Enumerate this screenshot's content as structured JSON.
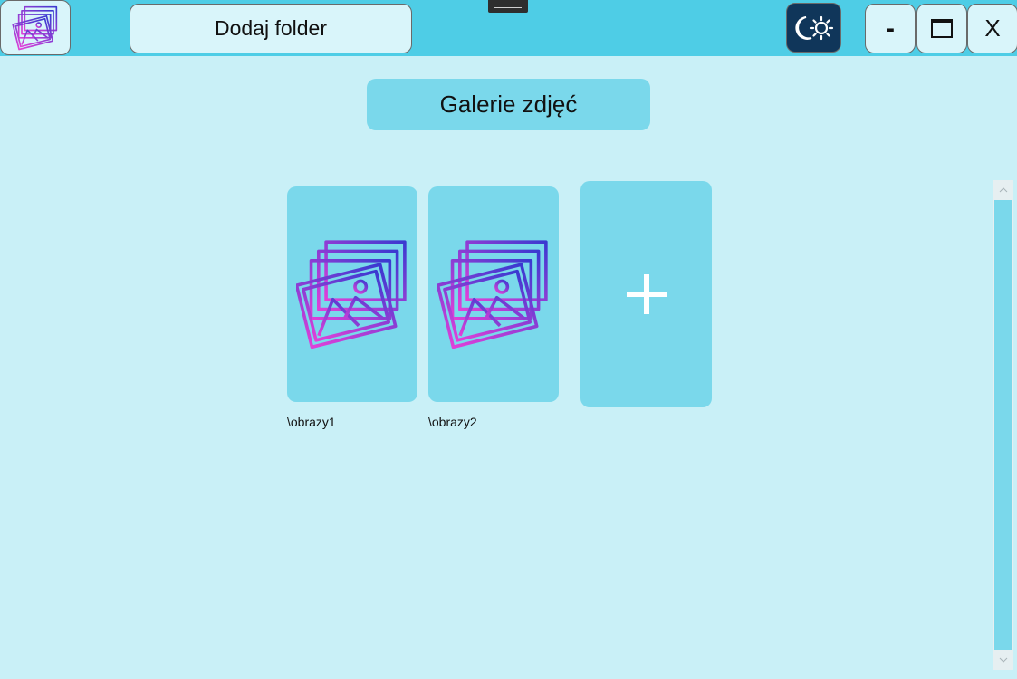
{
  "titlebar": {
    "add_folder_label": "Dodaj folder",
    "app_icon": "gallery-icon",
    "theme_icon": "moon-sun-icon",
    "minimize_label": "-",
    "maximize_icon": "maximize-icon",
    "close_label": "X"
  },
  "main": {
    "title": "Galerie zdjęć",
    "folders": [
      {
        "label": "\\obrazy1",
        "icon": "gallery-icon"
      },
      {
        "label": "\\obrazy2",
        "icon": "gallery-icon"
      }
    ],
    "add_card_icon": "plus-icon"
  },
  "colors": {
    "titlebar_bg": "#4ecde6",
    "page_bg": "#c9f0f7",
    "card_bg": "#7ad8eb",
    "button_bg": "#d9f5fa",
    "theme_button_bg": "#10365a",
    "icon_gradient_start": "#e040d8",
    "icon_gradient_end": "#3a3ad0"
  }
}
